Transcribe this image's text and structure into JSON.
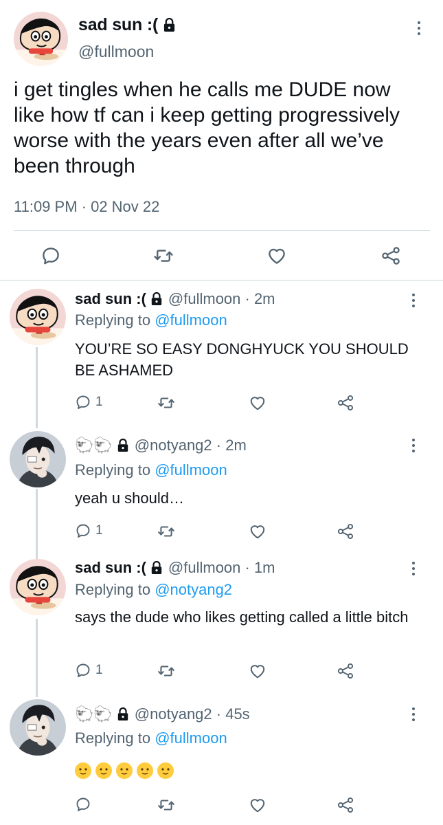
{
  "main_tweet": {
    "display_name": "sad sun :(",
    "handle": "@fullmoon",
    "text": "i get tingles when he calls me DUDE now like how tf can i keep getting progressively worse with the years even after all we’ve been through",
    "timestamp": "11:09 PM · 02 Nov 22"
  },
  "replies": [
    {
      "display_name": "sad sun :(",
      "handle_time": "@fullmoon · 2m",
      "replying_prefix": "Replying to ",
      "replying_to": "@fullmoon",
      "text": "YOU’RE SO EASY DONGHYUCK YOU SHOULD BE ASHAMED",
      "reply_count": "1"
    },
    {
      "display_name": "🐑🐑",
      "handle_time": "@notyang2 · 2m",
      "replying_prefix": "Replying to ",
      "replying_to": "@fullmoon",
      "text": "yeah u should…",
      "reply_count": "1"
    },
    {
      "display_name": "sad sun :(",
      "handle_time": "@fullmoon · 1m",
      "replying_prefix": "Replying to ",
      "replying_to": "@notyang2",
      "text": "says the dude who likes getting called a little bitch",
      "reply_count": "1"
    },
    {
      "display_name": "🐑🐑",
      "handle_time": "@notyang2 · 45s",
      "replying_prefix": "Replying to ",
      "replying_to": "@fullmoon",
      "text": "",
      "emojis": [
        "🫠",
        "😵‍💫",
        "😳",
        "😏",
        "☺️"
      ],
      "reply_count": ""
    }
  ],
  "icons": [
    "lock-icon",
    "more-icon",
    "reply-icon",
    "retweet-icon",
    "like-icon",
    "share-icon"
  ],
  "colors": {
    "link": "#1d9bf0",
    "secondary": "#536471",
    "divider": "#cfd9de"
  }
}
